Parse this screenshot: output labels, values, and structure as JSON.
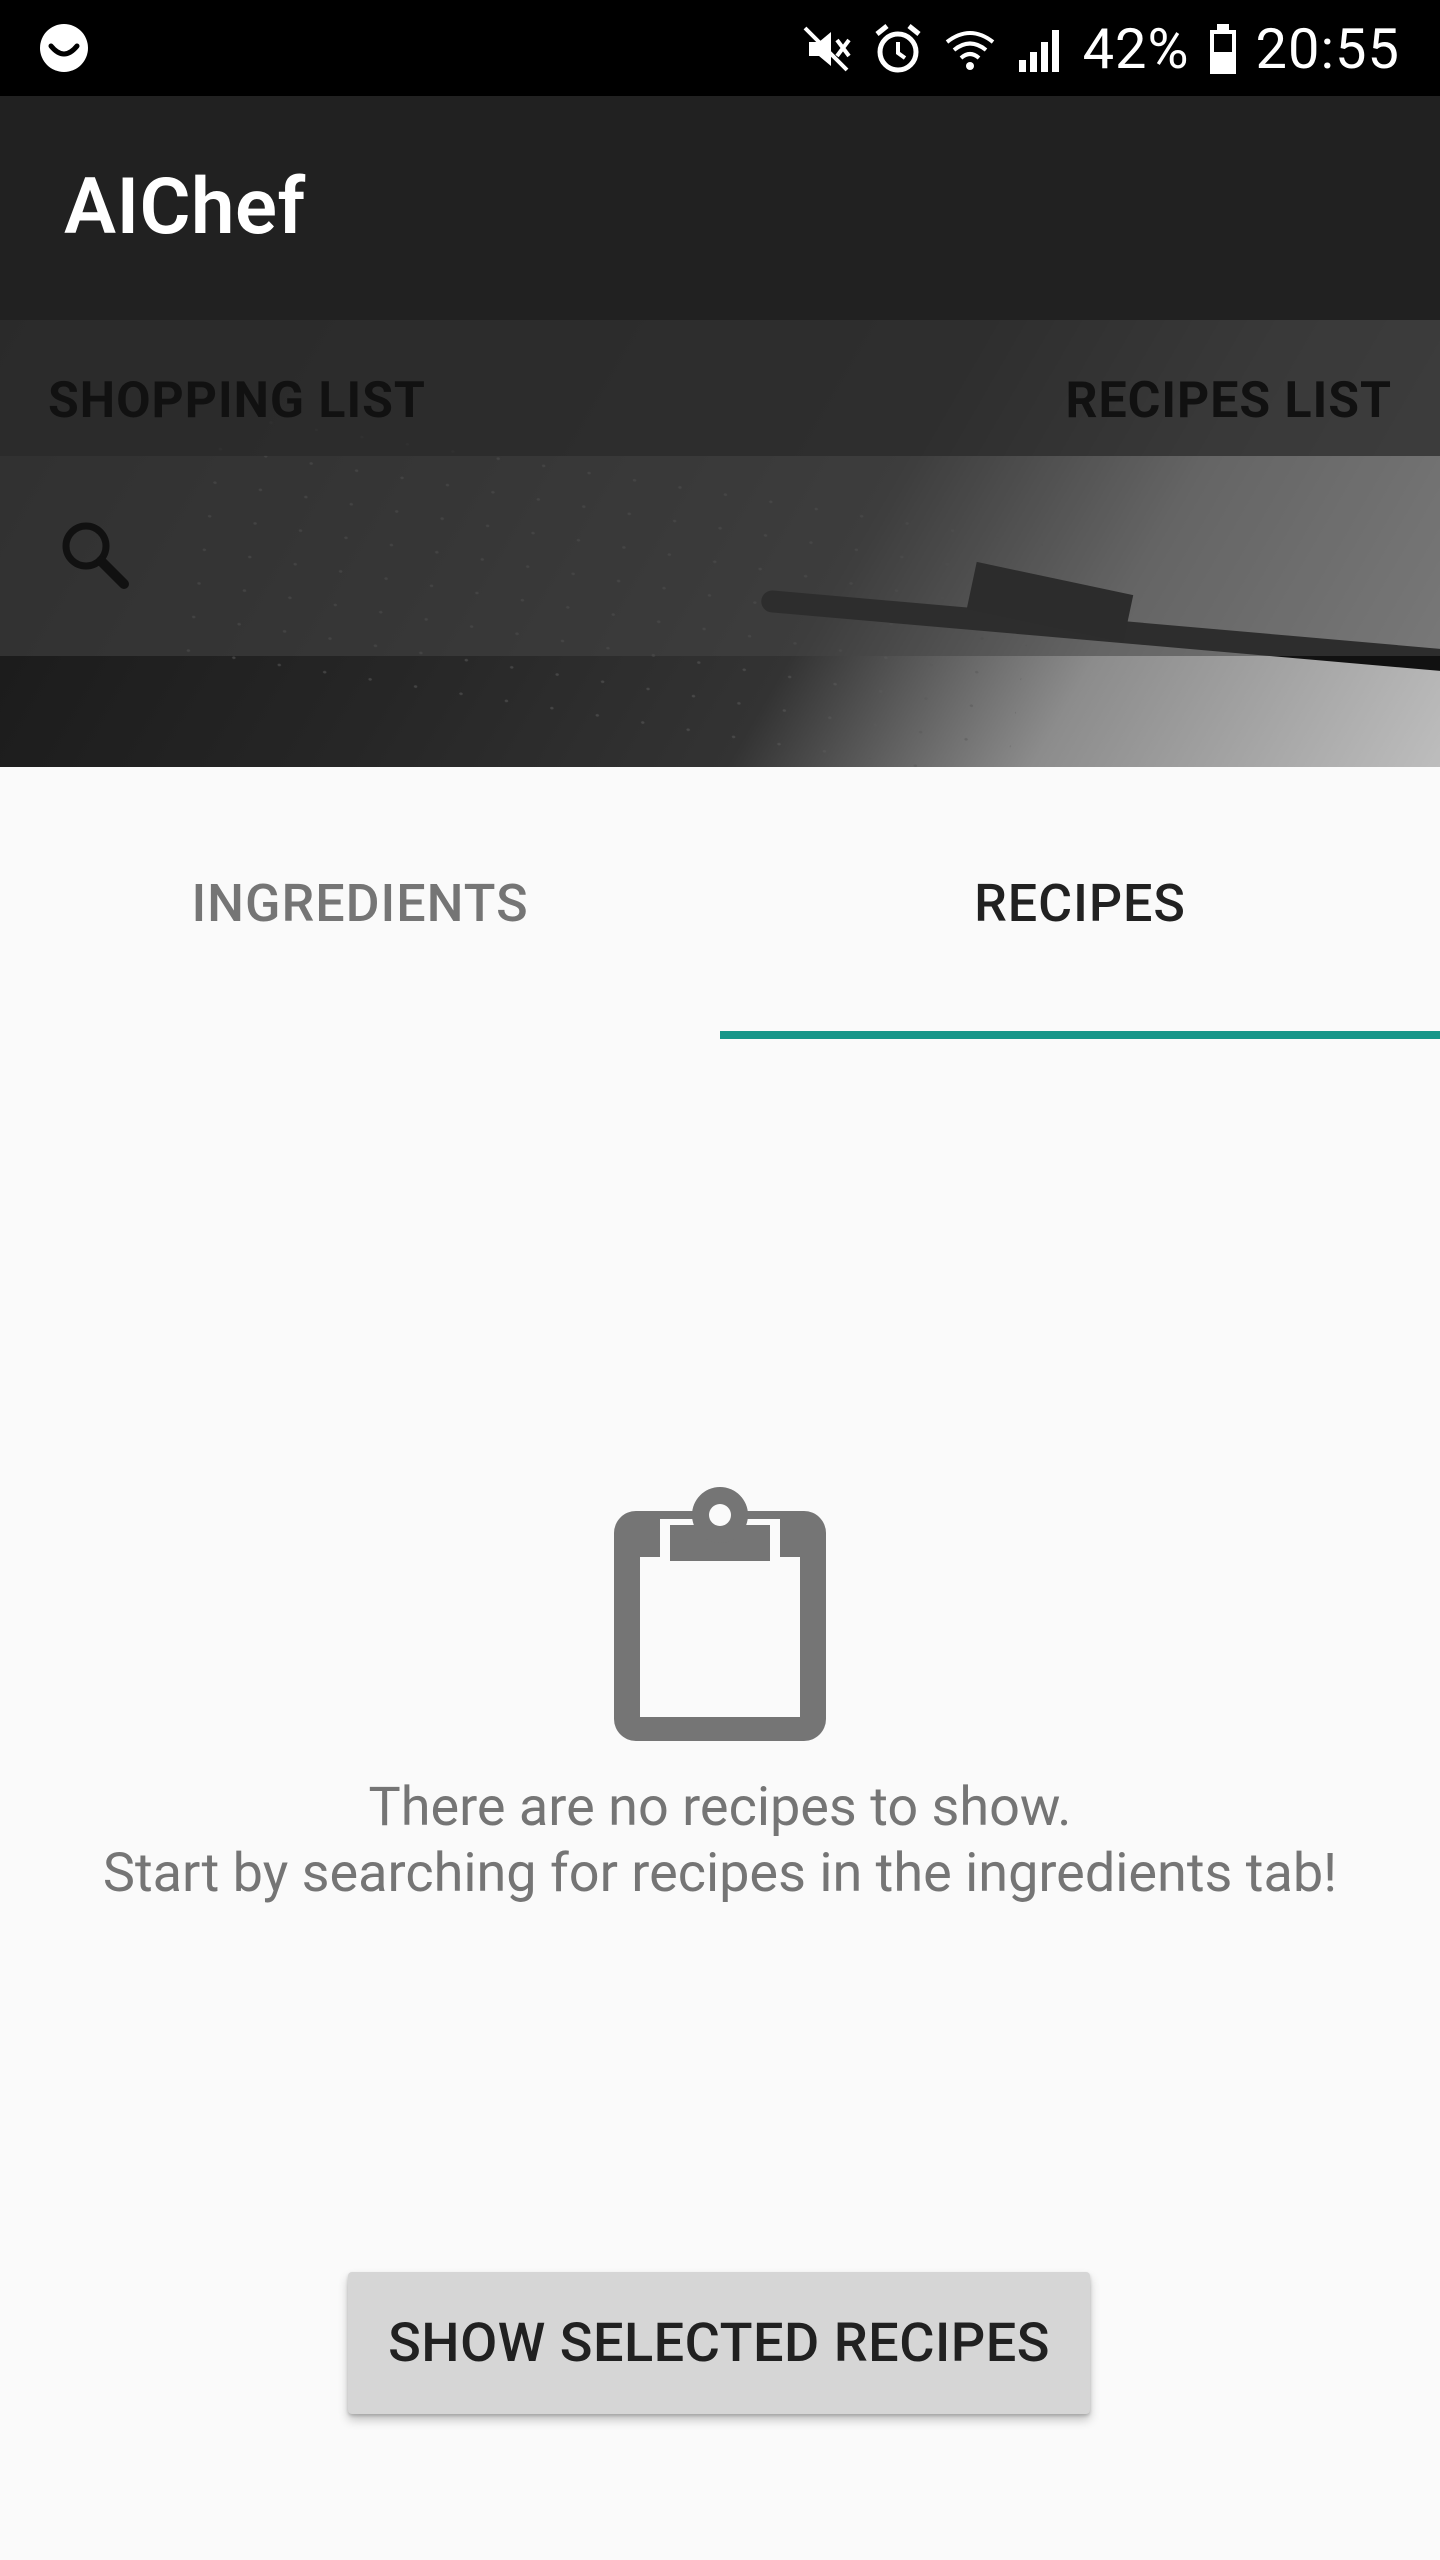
{
  "status_bar": {
    "battery_percent": "42%",
    "time": "20:55",
    "icons": [
      "smiley-notification-icon",
      "mute-icon",
      "alarm-icon",
      "wifi-icon",
      "signal-icon",
      "battery-icon"
    ]
  },
  "app_bar": {
    "title": "AIChef"
  },
  "top_tabs": [
    {
      "label": "SHOPPING LIST"
    },
    {
      "label": "RECIPES LIST"
    }
  ],
  "search": {
    "icon": "search-icon"
  },
  "tabs": [
    {
      "label": "INGREDIENTS",
      "selected": false
    },
    {
      "label": "RECIPES",
      "selected": true
    }
  ],
  "empty_state": {
    "icon": "clipboard-icon",
    "line1": "There are no recipes to show.",
    "line2": "Start by searching for recipes in the ingredients tab!"
  },
  "action_button": {
    "label": "SHOW SELECTED RECIPES"
  },
  "colors": {
    "status_bar": "#000000",
    "app_bar": "#212121",
    "tab_indicator": "#169689",
    "background": "#fafafa",
    "button": "#d6d6d6"
  }
}
